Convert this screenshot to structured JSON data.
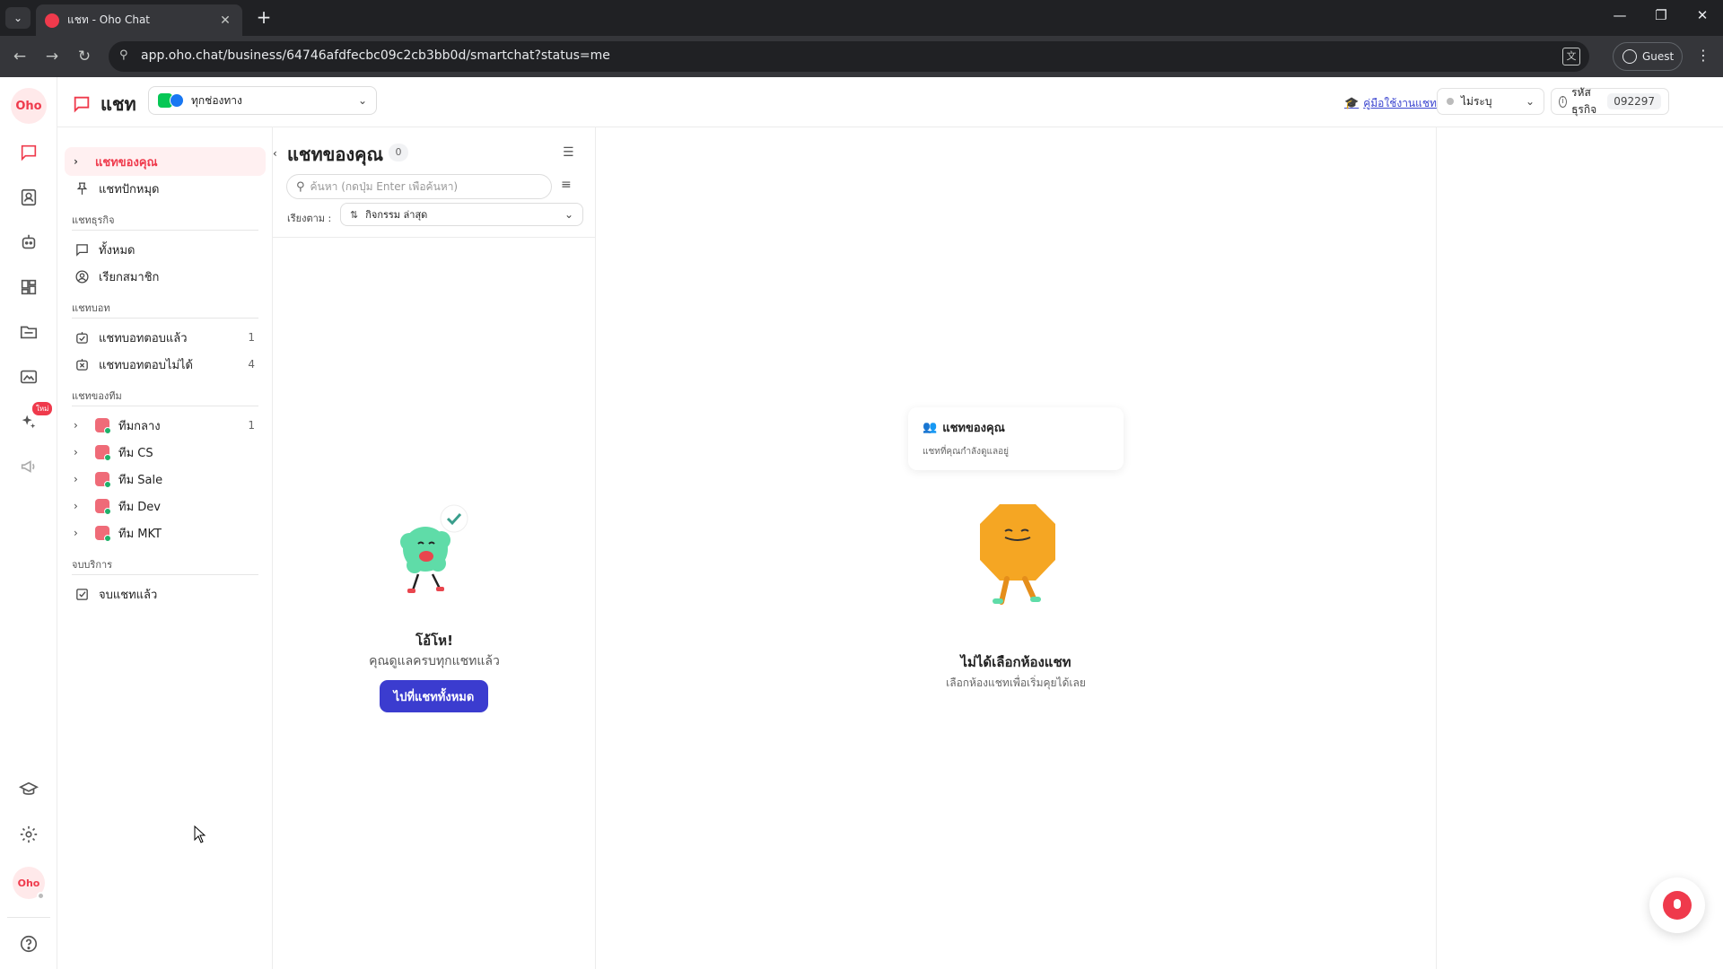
{
  "browser": {
    "tab_title": "แชท - Oho Chat",
    "url": "app.oho.chat/business/64746afdfecbc09c2cb3bb0d/smartchat?status=me",
    "profile_label": "Guest",
    "tab_close": "✕",
    "new_tab": "+",
    "tab_list": "⌄",
    "min": "—",
    "restore": "❐",
    "close": "✕",
    "back": "←",
    "forward": "→",
    "reload": "↻",
    "site_info": "⚲",
    "translate": "文",
    "menu": "⋮"
  },
  "rail": {
    "logo": "Oho",
    "avatar": "Oho",
    "new_badge": "ใหม่"
  },
  "header": {
    "title": "แชท",
    "channel_label": "ทุกช่องทาง",
    "guide_link": "คู่มือใช้งานแชท",
    "status_label": "ไม่ระบุ",
    "biz_code_label": "รหัสธุรกิจ",
    "biz_code": "092297",
    "chevron": "⌄",
    "info": "i",
    "guide_icon": "🎓"
  },
  "leftnav": {
    "my_chats": "แชทของคุณ",
    "pinned": "แชทปักหมุด",
    "section_business": "แชทธุรกิจ",
    "all": "ทั้งหมด",
    "call_member": "เรียกสมาชิก",
    "section_bot": "แชทบอท",
    "bot_answered": "แชทบอทตอบแล้ว",
    "bot_answered_count": "1",
    "bot_unanswered": "แชทบอทตอบไม่ได้",
    "bot_unanswered_count": "4",
    "section_team": "แชทของทีม",
    "teams": [
      {
        "label": "ทีมกลาง",
        "count": "1"
      },
      {
        "label": "ทีม CS",
        "count": ""
      },
      {
        "label": "ทีม Sale",
        "count": ""
      },
      {
        "label": "ทีม Dev",
        "count": ""
      },
      {
        "label": "ทีม MKT",
        "count": ""
      }
    ],
    "section_closed": "จบบริการ",
    "closed": "จบแชทแล้ว",
    "expand": "›"
  },
  "chatlist": {
    "title": "แชทของคุณ",
    "count": "0",
    "search_placeholder": "ค้นหา (กดปุ่ม Enter เพื่อค้นหา)",
    "sort_label": "เรียงตาม :",
    "sort_value": "กิจกรรม ล่าสุด",
    "empty_title": "โอ้โห!",
    "empty_sub": "คุณดูแลครบทุกแชทแล้ว",
    "go_all_button": "ไปที่แชททั้งหมด",
    "collapse": "‹",
    "view_icon": "☰",
    "filter_icon": "≡",
    "search_icon": "⚲",
    "sort_icon": "⇅",
    "chevron": "⌄"
  },
  "main": {
    "tip_title": "แชทของคุณ",
    "tip_sub": "แชทที่คุณกำลังดูแลอยู่",
    "empty_title": "ไม่ได้เลือกห้องแชท",
    "empty_sub": "เลือกห้องแชทเพื่อเริ่มคุยได้เลย",
    "person_icon": "👥"
  }
}
